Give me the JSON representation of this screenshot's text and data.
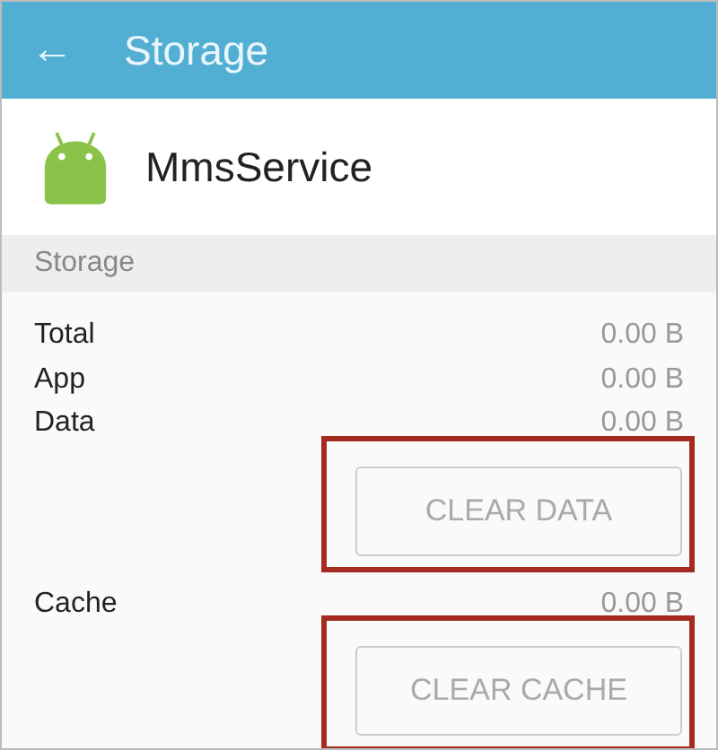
{
  "app_bar": {
    "back_icon": "←",
    "title": "Storage"
  },
  "app": {
    "name": "MmsService"
  },
  "section": {
    "title": "Storage"
  },
  "groups": [
    {
      "rows": [
        {
          "label": "Total",
          "value": "0.00 B"
        },
        {
          "label": "App",
          "value": "0.00 B"
        },
        {
          "label": "Data",
          "value": "0.00 B"
        }
      ],
      "button": {
        "label": "CLEAR DATA",
        "disabled": true,
        "highlighted": true
      }
    },
    {
      "rows": [
        {
          "label": "Cache",
          "value": "0.00 B"
        }
      ],
      "button": {
        "label": "CLEAR CACHE",
        "disabled": true,
        "highlighted": true
      }
    }
  ]
}
